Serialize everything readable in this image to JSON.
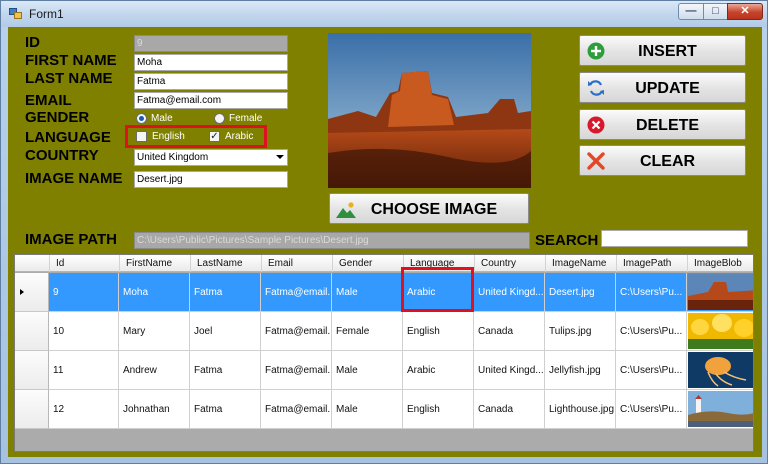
{
  "window": {
    "title": "Form1",
    "min_glyph": "—",
    "max_glyph": "□",
    "close_glyph": "✕"
  },
  "form": {
    "id_label": "ID",
    "id_value": "9",
    "first_name_label": "FIRST NAME",
    "first_name_value": "Moha",
    "last_name_label": "LAST NAME",
    "last_name_value": "Fatma",
    "email_label": "EMAIL",
    "email_value": "Fatma@email.com",
    "gender_label": "GENDER",
    "gender_options": [
      "Male",
      "Female"
    ],
    "gender_selected": "Male",
    "language_label": "LANGUAGE",
    "language_options": [
      {
        "label": "English",
        "checked": false
      },
      {
        "label": "Arabic",
        "checked": true
      }
    ],
    "country_label": "COUNTRY",
    "country_value": "United Kingdom",
    "image_name_label": "IMAGE NAME",
    "image_name_value": "Desert.jpg",
    "image_path_label": "IMAGE PATH",
    "image_path_value": "C:\\Users\\Public\\Pictures\\Sample Pictures\\Desert.jpg",
    "search_label": "SEARCH",
    "search_value": ""
  },
  "buttons": {
    "insert": "INSERT",
    "update": "UPDATE",
    "delete": "DELETE",
    "clear": "CLEAR",
    "choose_image": "CHOOSE IMAGE"
  },
  "grid": {
    "columns": [
      "Id",
      "FirstName",
      "LastName",
      "Email",
      "Gender",
      "Language",
      "Country",
      "ImageName",
      "ImagePath",
      "ImageBlob"
    ],
    "rows": [
      {
        "id": "9",
        "first": "Moha",
        "last": "Fatma",
        "email": "Fatma@email...",
        "gender": "Male",
        "language": "Arabic",
        "country": "United Kingd...",
        "image_name": "Desert.jpg",
        "image_path": "C:\\Users\\Pu...",
        "blob_icon": "desert-thumbnail"
      },
      {
        "id": "10",
        "first": "Mary",
        "last": "Joel",
        "email": "Fatma@email...",
        "gender": "Female",
        "language": "English",
        "country": "Canada",
        "image_name": "Tulips.jpg",
        "image_path": "C:\\Users\\Pu...",
        "blob_icon": "tulips-thumbnail"
      },
      {
        "id": "11",
        "first": "Andrew",
        "last": "Fatma",
        "email": "Fatma@email...",
        "gender": "Male",
        "language": "Arabic",
        "country": "United Kingd...",
        "image_name": "Jellyfish.jpg",
        "image_path": "C:\\Users\\Pu...",
        "blob_icon": "jellyfish-thumbnail"
      },
      {
        "id": "12",
        "first": "Johnathan",
        "last": "Fatma",
        "email": "Fatma@email...",
        "gender": "Male",
        "language": "English",
        "country": "Canada",
        "image_name": "Lighthouse.jpg",
        "image_path": "C:\\Users\\Pu...",
        "blob_icon": "lighthouse-thumbnail"
      }
    ],
    "selected_row": 0
  },
  "colors": {
    "form_background": "#808000",
    "selection": "#3399ff",
    "highlight_box": "#e0111e"
  }
}
